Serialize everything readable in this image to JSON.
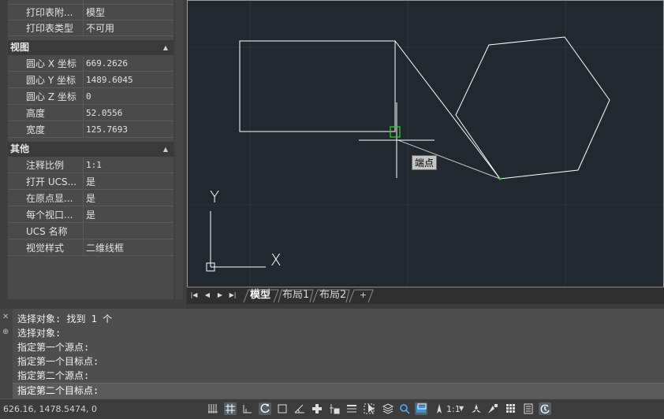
{
  "palette": {
    "rows_top": [
      {
        "label": "打印表附...",
        "value": "模型"
      },
      {
        "label": "打印表类型",
        "value": "不可用"
      }
    ],
    "section_view": {
      "title": "视图",
      "rows": [
        {
          "label": "圆心 X 坐标",
          "value": "669.2626"
        },
        {
          "label": "圆心 Y 坐标",
          "value": "1489.6045"
        },
        {
          "label": "圆心 Z 坐标",
          "value": "0"
        },
        {
          "label": "高度",
          "value": "52.0556"
        },
        {
          "label": "宽度",
          "value": "125.7693"
        }
      ]
    },
    "section_misc": {
      "title": "其他",
      "rows": [
        {
          "label": "注释比例",
          "value": "1:1"
        },
        {
          "label": "打开 UCS...",
          "value": "是"
        },
        {
          "label": "在原点显...",
          "value": "是"
        },
        {
          "label": "每个视口...",
          "value": "是"
        },
        {
          "label": "UCS 名称",
          "value": ""
        },
        {
          "label": "视觉样式",
          "value": "二维线框"
        }
      ]
    }
  },
  "drawing": {
    "snap_tooltip": "端点",
    "ucs_x_label": "X",
    "ucs_y_label": "Y",
    "colors": {
      "background": "#212830",
      "lines": "#ffffff",
      "snap_marker": "#1fd21f",
      "rubberband": "#c8c8c8"
    }
  },
  "layout_tabs": {
    "tabs": [
      "模型",
      "布局1",
      "布局2",
      "+"
    ],
    "active": "模型"
  },
  "command": {
    "history": [
      "选择对象: 找到 1 个",
      "选择对象:",
      "指定第一个源点:",
      "指定第一个目标点:",
      "指定第二个源点:"
    ],
    "prompt": "指定第二个目标点:"
  },
  "status": {
    "coordinates": "626.16, 1478.5474, 0",
    "annotation_scale": "1:1",
    "icons": [
      "model-space-icon",
      "grid-icon",
      "snap-icon",
      "ortho-icon",
      "polar-icon",
      "isodraft-icon",
      "object-snap-tracking-icon",
      "object-snap-icon",
      "lineweight-icon",
      "transparency-icon",
      "selection-cycling-icon",
      "3d-osnap-icon",
      "dynamic-ucs-icon",
      "annotation-visibility-icon",
      "annotation-scale-icon",
      "workspace-icon",
      "annotation-monitor-icon",
      "isolate-objects-icon",
      "hardware-acceleration-icon",
      "clean-screen-icon"
    ]
  }
}
